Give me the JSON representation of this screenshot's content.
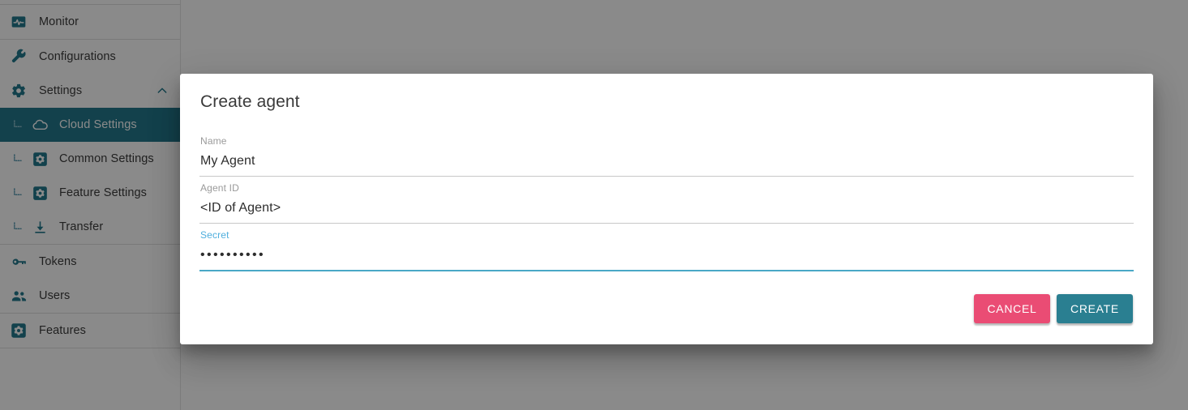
{
  "colors": {
    "accent_teal": "#22798c",
    "selected_item_bg": "#23798c",
    "focus_blue": "#4eaedd",
    "focus_underline": "#4aa8c6",
    "cancel_pink": "#ea4c74",
    "create_teal": "#2a7f91",
    "scrim": "rgba(0,0,0,0.46)"
  },
  "sidebar": {
    "groups": [
      {
        "items": [
          {
            "label": "Monitor",
            "icon": "monitor-icon",
            "type": "item"
          }
        ]
      },
      {
        "items": [
          {
            "label": "Configurations",
            "icon": "wrench-icon",
            "type": "item"
          },
          {
            "label": "Settings",
            "icon": "gear-icon",
            "type": "item",
            "expanded": true,
            "chevron": "chevron-up-icon"
          },
          {
            "label": "Cloud Settings",
            "icon": "cloud-icon",
            "type": "sub",
            "active": true
          },
          {
            "label": "Common Settings",
            "icon": "gear-square-icon",
            "type": "sub",
            "active": false
          },
          {
            "label": "Feature Settings",
            "icon": "gear-square-icon",
            "type": "sub",
            "active": false
          },
          {
            "label": "Transfer",
            "icon": "download-icon",
            "type": "sub",
            "active": false
          }
        ]
      },
      {
        "items": [
          {
            "label": "Tokens",
            "icon": "key-icon",
            "type": "item"
          },
          {
            "label": "Users",
            "icon": "users-icon",
            "type": "item"
          }
        ]
      },
      {
        "items": [
          {
            "label": "Features",
            "icon": "gear-square-icon",
            "type": "item"
          }
        ]
      }
    ]
  },
  "dialog": {
    "title": "Create agent",
    "fields": [
      {
        "label": "Name",
        "value": "My Agent",
        "placeholder": "Name",
        "focused": false,
        "masked": false
      },
      {
        "label": "Agent ID",
        "value": "<ID of Agent>",
        "placeholder": "Agent ID",
        "focused": false,
        "masked": false
      },
      {
        "label": "Secret",
        "value": "••••••••••",
        "placeholder": "Secret",
        "focused": true,
        "masked": true,
        "mask_char_count": 10
      }
    ],
    "buttons": {
      "cancel_label": "CANCEL",
      "create_label": "CREATE"
    }
  }
}
